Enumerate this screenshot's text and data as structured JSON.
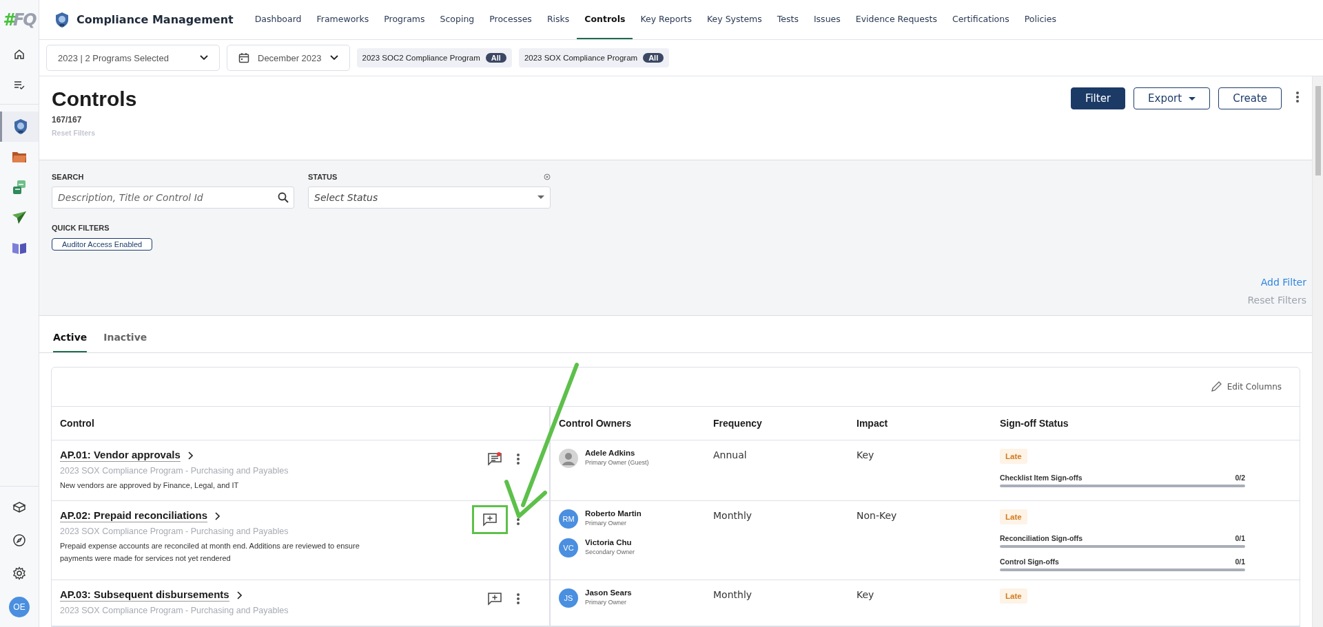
{
  "logo": {
    "mark": "#",
    "text": "FQ"
  },
  "sidebar": {
    "items": [
      {
        "kind": "home",
        "selected": false
      },
      {
        "kind": "list-check",
        "selected": false
      },
      {
        "kind": "shield",
        "selected": true
      },
      {
        "kind": "folder",
        "selected": false
      },
      {
        "kind": "squares",
        "selected": false
      },
      {
        "kind": "plane",
        "selected": false
      },
      {
        "kind": "book",
        "selected": false
      }
    ],
    "bottom_items": [
      {
        "kind": "cube"
      },
      {
        "kind": "compass"
      },
      {
        "kind": "gear"
      }
    ],
    "user_avatar": "OE"
  },
  "app": {
    "title": "Compliance Management"
  },
  "nav": {
    "tabs": [
      {
        "label": "Dashboard",
        "selected": false
      },
      {
        "label": "Frameworks",
        "selected": false
      },
      {
        "label": "Programs",
        "selected": false
      },
      {
        "label": "Scoping",
        "selected": false
      },
      {
        "label": "Processes",
        "selected": false
      },
      {
        "label": "Risks",
        "selected": false
      },
      {
        "label": "Controls",
        "selected": true
      },
      {
        "label": "Key Reports",
        "selected": false
      },
      {
        "label": "Key Systems",
        "selected": false
      },
      {
        "label": "Tests",
        "selected": false
      },
      {
        "label": "Issues",
        "selected": false
      },
      {
        "label": "Evidence Requests",
        "selected": false
      },
      {
        "label": "Certifications",
        "selected": false
      },
      {
        "label": "Policies",
        "selected": false
      }
    ]
  },
  "context_bar": {
    "program_select": "2023 | 2 Programs Selected",
    "period_select": "December 2023",
    "programs": [
      {
        "name": "2023 SOC2 Compliance Program",
        "badge": "All"
      },
      {
        "name": "2023 SOX Compliance Program",
        "badge": "All"
      }
    ]
  },
  "header": {
    "title": "Controls",
    "count": "167/167",
    "reset_filters": "Reset Filters",
    "buttons": [
      {
        "label": "Filter",
        "kind": "primary"
      },
      {
        "label": "Export",
        "kind": "dropdown"
      },
      {
        "label": "Create",
        "kind": "outline"
      }
    ]
  },
  "filters": {
    "search_label": "SEARCH",
    "search_placeholder": "Description, Title or Control Id",
    "status_label": "STATUS",
    "status_placeholder": "Select Status",
    "quick_filters_label": "QUICK FILTERS",
    "quick_filters": [
      "Auditor Access Enabled"
    ],
    "add_filter": "Add Filter",
    "reset_filters": "Reset Filters"
  },
  "tabs": [
    {
      "label": "Active",
      "selected": true
    },
    {
      "label": "Inactive",
      "selected": false
    }
  ],
  "table": {
    "edit_columns": "Edit Columns",
    "columns": [
      "Control",
      "Control Owners",
      "Frequency",
      "Impact",
      "Sign-off Status"
    ],
    "rows": [
      {
        "title": "AP.01: Vendor approvals",
        "subtitle": "2023 SOX Compliance Program - Purchasing and Payables",
        "description": "New vendors are approved by Finance, Legal, and IT",
        "comment": {
          "kind": "messages",
          "unread": true,
          "highlighted": false
        },
        "owners": [
          {
            "name": "Adele Adkins",
            "role": "Primary Owner (Guest)",
            "avatar": {
              "kind": "photo"
            }
          }
        ],
        "frequency": "Annual",
        "impact": "Key",
        "status": "Late",
        "signoffs": [
          {
            "label": "Checklist Item Sign-offs",
            "count": "0/2",
            "level": 0
          }
        ]
      },
      {
        "title": "AP.02: Prepaid reconciliations",
        "subtitle": "2023 SOX Compliance Program - Purchasing and Payables",
        "description": "Prepaid expense accounts are reconciled at month end. Additions are reviewed to ensure payments were made for services not yet rendered",
        "comment": {
          "kind": "add",
          "unread": false,
          "highlighted": true
        },
        "owners": [
          {
            "name": "Roberto Martin",
            "role": "Primary Owner",
            "avatar": {
              "kind": "initials",
              "initials": "RM"
            }
          },
          {
            "name": "Victoria Chu",
            "role": "Secondary Owner",
            "avatar": {
              "kind": "initials",
              "initials": "VC"
            }
          }
        ],
        "frequency": "Monthly",
        "impact": "Non-Key",
        "status": "Late",
        "signoffs": [
          {
            "label": "Reconciliation Sign-offs",
            "count": "0/1",
            "level": 0
          },
          {
            "label": "Control Sign-offs",
            "count": "0/1",
            "level": 0
          }
        ]
      },
      {
        "title": "AP.03: Subsequent disbursements",
        "subtitle": "2023 SOX Compliance Program - Purchasing and Payables",
        "comment": {
          "kind": "add",
          "unread": false,
          "highlighted": false
        },
        "owners": [
          {
            "name": "Jason Sears",
            "role": "Primary Owner",
            "avatar": {
              "kind": "initials",
              "initials": "JS"
            }
          }
        ],
        "frequency": "Monthly",
        "impact": "Key",
        "status": "Late",
        "signoffs": []
      }
    ]
  }
}
